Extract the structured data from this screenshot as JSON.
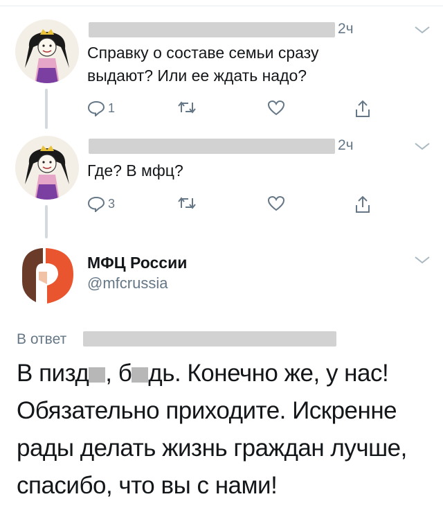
{
  "tweets": [
    {
      "time": "2ч",
      "text": "Справку о составе семьи сразу выдают? Или ее ждать надо?",
      "reply_count": "1"
    },
    {
      "time": "2ч",
      "text": "Где? В мфц?",
      "reply_count": "3"
    }
  ],
  "reply": {
    "author_name": "МФЦ России",
    "author_handle": "@mfcrussia",
    "reply_to_label": "В ответ",
    "text_part1": "В пизд",
    "text_part2": ", б",
    "text_part3": "дь. Конечно же, у нас! Обязательно приходите. Искренне рады делать жизнь граждан лучше, спасибо, что вы с нами!"
  },
  "colors": {
    "muted": "#657786",
    "text": "#14171a",
    "thread_line": "#d3d9de",
    "logo_red": "#e8552f",
    "logo_brown": "#6b3b2a"
  },
  "icons": [
    "reply-icon",
    "retweet-icon",
    "like-icon",
    "share-icon",
    "chevron-down-icon",
    "mfc-logo"
  ]
}
